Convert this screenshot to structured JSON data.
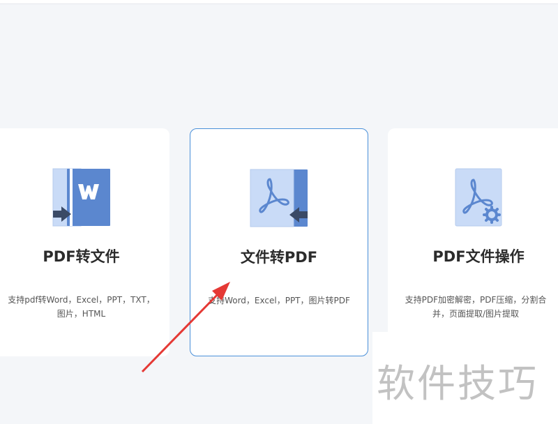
{
  "cards": [
    {
      "title": "PDF转文件",
      "desc": "支持pdf转Word，Excel，PPT，TXT，图片，HTML",
      "icon": "pdf-to-word-icon"
    },
    {
      "title": "文件转PDF",
      "desc": "支持Word，Excel，PPT，图片转PDF",
      "icon": "file-to-pdf-icon"
    },
    {
      "title": "PDF文件操作",
      "desc": "支持PDF加密解密，PDF压缩，分割合并，页面提取/图片提取",
      "icon": "pdf-operations-icon"
    }
  ],
  "watermark": "软件技巧",
  "colors": {
    "accent": "#4a90d9",
    "icon_dark": "#5b87cf",
    "icon_light": "#c9dbf7",
    "arrow": "#e53935"
  }
}
